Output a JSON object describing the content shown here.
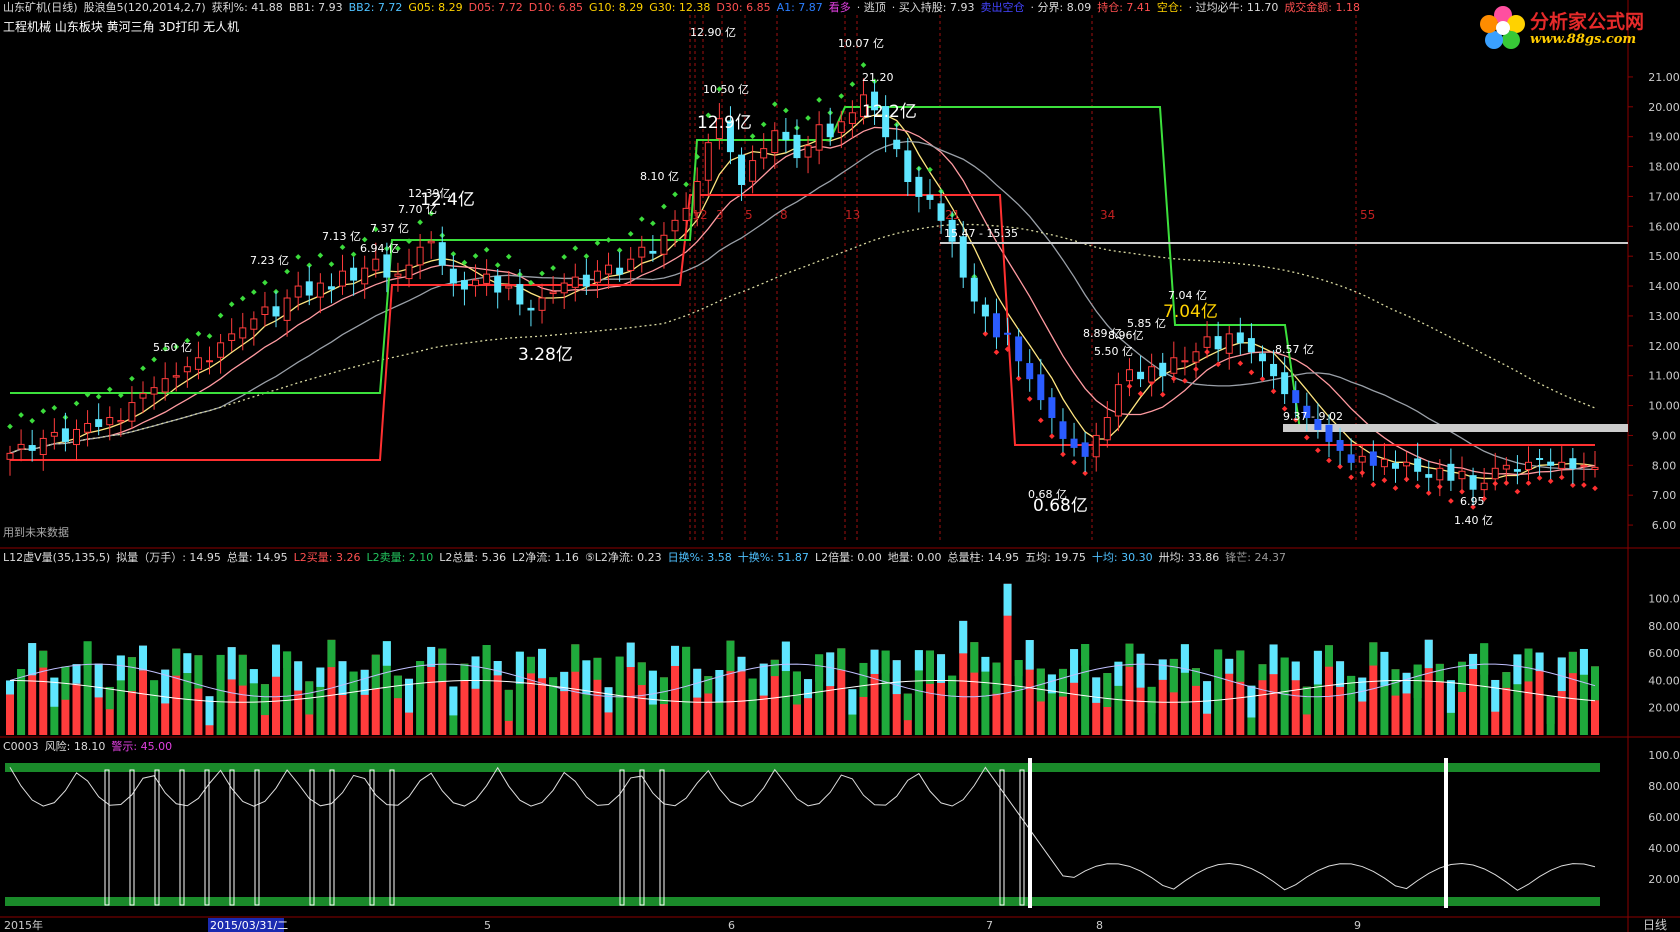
{
  "header": {
    "line1": [
      {
        "text": "山东矿机(日线)",
        "color": "#dcdcdc"
      },
      {
        "text": "股浪鱼5(120,2014,2,7)",
        "color": "#dcdcdc"
      },
      {
        "text": "获利%: 41.88",
        "color": "#dcdcdc"
      },
      {
        "text": "BB1: 7.93",
        "color": "#dcdcdc"
      },
      {
        "text": "BB2: 7.72",
        "color": "#4fc1ff"
      },
      {
        "text": "G05: 8.29",
        "color": "#ffd200"
      },
      {
        "text": "D05: 7.72",
        "color": "#ff5050"
      },
      {
        "text": "D10: 6.85",
        "color": "#ff5050"
      },
      {
        "text": "G10: 8.29",
        "color": "#ffd200"
      },
      {
        "text": "G30: 12.38",
        "color": "#ffd200"
      },
      {
        "text": "D30: 6.85",
        "color": "#ff5050"
      },
      {
        "text": "A1: 7.87",
        "color": "#2b7fff"
      },
      {
        "text": "看多",
        "color": "#e040e0"
      },
      {
        "text": "· 逃顶",
        "color": "#dcdcdc"
      },
      {
        "text": "· 买入持股: 7.93",
        "color": "#dcdcdc"
      },
      {
        "text": "卖出空仓",
        "color": "#4444ff"
      },
      {
        "text": "· 分界: 8.09",
        "color": "#dcdcdc"
      },
      {
        "text": "持仓: 7.41",
        "color": "#ff5050"
      },
      {
        "text": "空仓:",
        "color": "#ffd200"
      },
      {
        "text": "· 过均必牛: 11.70",
        "color": "#dcdcdc"
      },
      {
        "text": "成交金额: 1.18",
        "color": "#ff5050"
      }
    ],
    "line2": "工程机械 山东板块 黄河三角 3D打印 无人机"
  },
  "logo": {
    "title": "分析家公式网",
    "url": "www.88gs.com"
  },
  "main_panel": {
    "note": "用到未来数据",
    "y_ticks": [
      "21.00",
      "20.00",
      "19.00",
      "18.00",
      "17.00",
      "16.00",
      "15.00",
      "14.00",
      "13.00",
      "12.00",
      "11.00",
      "10.00",
      "9.00",
      "8.00",
      "7.00",
      "6.00"
    ],
    "annotations": [
      {
        "text": "12.90 亿",
        "c": "#ffffff"
      },
      {
        "text": "10.07 亿",
        "c": "#ffffff"
      },
      {
        "text": "21.20",
        "c": "#ffffff"
      },
      {
        "text": "10.50 亿",
        "c": "#ffffff"
      },
      {
        "text": "12.9亿",
        "c": "#ffffff",
        "big": true
      },
      {
        "text": "12.2亿",
        "c": "#ffffff",
        "big": true
      },
      {
        "text": "8.10 亿",
        "c": "#ffffff"
      },
      {
        "text": "12.39亿",
        "c": "#ffffff"
      },
      {
        "text": "12.4亿",
        "c": "#ffffff",
        "big": true
      },
      {
        "text": "7.70 亿",
        "c": "#ffffff"
      },
      {
        "text": "7.13 亿",
        "c": "#ffffff"
      },
      {
        "text": "7.37 亿",
        "c": "#ffffff"
      },
      {
        "text": "6.94 亿",
        "c": "#ffffff"
      },
      {
        "text": "7.23 亿",
        "c": "#ffffff"
      },
      {
        "text": "5.50 亿",
        "c": "#ffffff"
      },
      {
        "text": "3.28亿",
        "c": "#ffffff",
        "big": true
      },
      {
        "text": "15.47 - 15.35",
        "c": "#ffffff"
      },
      {
        "text": "7.04 亿",
        "c": "#ffffff"
      },
      {
        "text": "7.04亿",
        "c": "#ffd200",
        "big": true
      },
      {
        "text": "5.85 亿",
        "c": "#ffffff"
      },
      {
        "text": "8.89 亿",
        "c": "#ffffff"
      },
      {
        "text": "8.96亿",
        "c": "#ffffff"
      },
      {
        "text": "5.50 亿",
        "c": "#ffffff"
      },
      {
        "text": "8.57 亿",
        "c": "#ffffff"
      },
      {
        "text": "9.37 - 9.02",
        "c": "#ffffff"
      },
      {
        "text": "0.68 亿",
        "c": "#ffffff"
      },
      {
        "text": "0.68亿",
        "c": "#ffffff",
        "big": true
      },
      {
        "text": "6.95",
        "c": "#ffffff"
      },
      {
        "text": "1.40 亿",
        "c": "#ffffff"
      }
    ],
    "period_labels": [
      "1",
      "2",
      "3",
      "5",
      "8",
      "13",
      "21",
      "34",
      "55"
    ]
  },
  "vol_panel": {
    "header": [
      {
        "text": "L12虚V量(35,135,5)",
        "c": "#dcdcdc"
      },
      {
        "text": "拟量（万手）: 14.95",
        "c": "#dcdcdc"
      },
      {
        "text": "总量: 14.95",
        "c": "#dcdcdc"
      },
      {
        "text": "L2买量: 3.26",
        "c": "#ff5050"
      },
      {
        "text": "L2卖量: 2.10",
        "c": "#22c55e"
      },
      {
        "text": "L2总量: 5.36",
        "c": "#dcdcdc"
      },
      {
        "text": "L2净流: 1.16",
        "c": "#dcdcdc"
      },
      {
        "text": "⑤L2净流: 0.23",
        "c": "#dcdcdc"
      },
      {
        "text": "日换%: 3.58",
        "c": "#4fc1ff"
      },
      {
        "text": "十换%: 51.87",
        "c": "#4fc1ff"
      },
      {
        "text": "L2倍量: 0.00",
        "c": "#dcdcdc"
      },
      {
        "text": "地量: 0.00",
        "c": "#dcdcdc"
      },
      {
        "text": "总量柱: 14.95",
        "c": "#dcdcdc"
      },
      {
        "text": "五均: 19.75",
        "c": "#dcdcdc"
      },
      {
        "text": "十均: 30.30",
        "c": "#4fc1ff"
      },
      {
        "text": "卅均: 33.86",
        "c": "#dcdcdc"
      },
      {
        "text": "锋芒: 24.37",
        "c": "#999999"
      }
    ],
    "y_ticks": [
      "100.0",
      "80.00",
      "60.00",
      "40.00",
      "20.00"
    ]
  },
  "risk_panel": {
    "header": [
      {
        "text": "C0003",
        "c": "#dcdcdc"
      },
      {
        "text": "风险: 18.10",
        "c": "#dcdcdc"
      },
      {
        "text": "警示: 45.00",
        "c": "#e040e0"
      }
    ],
    "y_ticks": [
      "100.0",
      "80.00",
      "60.00",
      "40.00",
      "20.00"
    ]
  },
  "time_axis": {
    "labels": [
      "2015年",
      "2015/03/31/二",
      "5",
      "6",
      "7",
      "8",
      "9"
    ],
    "period": "日线"
  },
  "chart_data": {
    "type": "candlestick",
    "title": "山东矿机(日线)",
    "ylim": [
      5.5,
      21.5
    ],
    "close": [
      8.4,
      8.7,
      8.5,
      8.9,
      9.1,
      8.8,
      9.2,
      9.4,
      9.3,
      9.6,
      9.5,
      10.1,
      10.4,
      10.6,
      10.9,
      11.0,
      11.3,
      11.6,
      11.5,
      12.1,
      12.4,
      12.6,
      12.9,
      13.3,
      13.0,
      13.6,
      14.0,
      13.7,
      14.1,
      13.9,
      14.5,
      14.2,
      14.6,
      14.9,
      14.3,
      14.4,
      14.7,
      15.3,
      15.5,
      14.7,
      14.1,
      13.9,
      14.2,
      14.4,
      13.8,
      14.0,
      13.4,
      13.2,
      13.6,
      13.8,
      14.1,
      14.3,
      14.0,
      14.5,
      14.7,
      14.4,
      14.9,
      15.3,
      15.1,
      15.7,
      16.2,
      16.6,
      17.5,
      18.8,
      19.6,
      18.5,
      17.4,
      18.2,
      18.6,
      19.2,
      18.9,
      18.3,
      18.7,
      19.4,
      19.0,
      19.5,
      19.8,
      20.4,
      19.9,
      19.0,
      18.6,
      17.5,
      17.0,
      16.9,
      16.2,
      15.5,
      14.3,
      13.5,
      13.0,
      12.3,
      12.4,
      11.5,
      10.9,
      10.2,
      9.6,
      8.9,
      8.6,
      8.3,
      9.0,
      9.6,
      10.7,
      11.2,
      10.9,
      11.3,
      11.0,
      11.6,
      11.5,
      11.8,
      12.3,
      11.9,
      12.4,
      12.1,
      11.8,
      11.5,
      11.0,
      10.4,
      10.1,
      9.6,
      9.2,
      8.8,
      8.5,
      8.1,
      8.3,
      8.0,
      8.2,
      7.9,
      8.1,
      7.8,
      7.6,
      7.9,
      7.5,
      7.8,
      7.2,
      7.4,
      7.9,
      8.0,
      7.8,
      8.1,
      8.2,
      8.0,
      8.1,
      7.9,
      8.0,
      7.93
    ]
  }
}
